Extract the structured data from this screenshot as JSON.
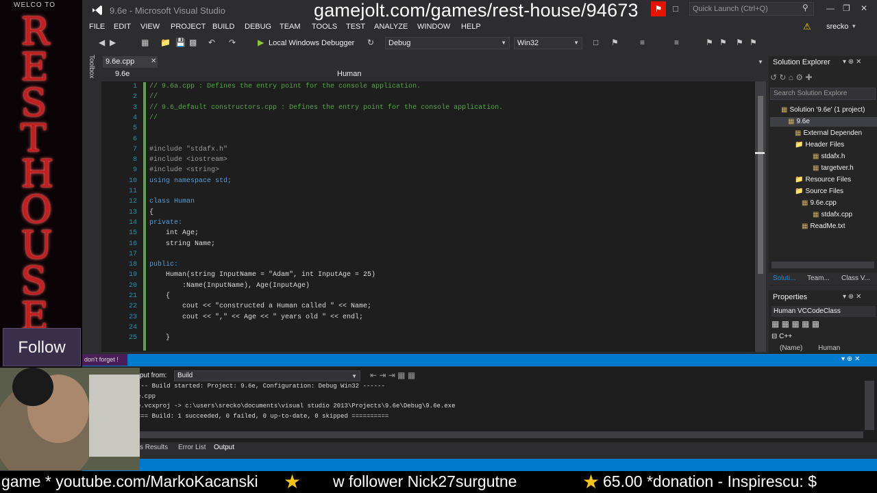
{
  "overlay": {
    "url": "gamejolt.com/games/rest-house/94673",
    "logo_top": "WELCO  TO",
    "logo_letters": [
      "R",
      "E",
      "S",
      "T",
      "H",
      "O",
      "U",
      "S",
      "E"
    ],
    "follow": "Follow",
    "dont_forget": "don't forget !",
    "ticker": {
      "segment1": "game * youtube.com/MarkoKacanski",
      "segment2": "w follower Nick27surgutne",
      "segment3": "65.00  *donation - Inspirescu: $"
    }
  },
  "window": {
    "title": "9.6e - Microsoft Visual Studio",
    "quick_launch_placeholder": "Quick Launch (Ctrl+Q)",
    "user": "srecko"
  },
  "menu": [
    "FILE",
    "EDIT",
    "VIEW",
    "PROJECT",
    "BUILD",
    "DEBUG",
    "TEAM",
    "TOOLS",
    "TEST",
    "ANALYZE",
    "WINDOW",
    "HELP"
  ],
  "toolbar": {
    "debugger": "Local Windows Debugger",
    "configuration": "Debug",
    "platform": "Win32"
  },
  "toolbox_label": "Toolbox",
  "editor": {
    "tab": "9.6e.cpp",
    "nav_scope": "9.6e",
    "nav_member": "Human",
    "lines": [
      {
        "n": "1",
        "t": "// 9.6a.cpp : Defines the entry point for the console application."
      },
      {
        "n": "2",
        "t": "//"
      },
      {
        "n": "3",
        "t": "// 9.6_default constructors.cpp : Defines the entry point for the console application."
      },
      {
        "n": "4",
        "t": "//"
      },
      {
        "n": "5",
        "t": ""
      },
      {
        "n": "6",
        "t": ""
      },
      {
        "n": "7",
        "t": "#include \"stdafx.h\""
      },
      {
        "n": "8",
        "t": "#include <iostream>"
      },
      {
        "n": "9",
        "t": "#include <string>"
      },
      {
        "n": "10",
        "t": "using namespace std;"
      },
      {
        "n": "11",
        "t": ""
      },
      {
        "n": "12",
        "t": "class Human"
      },
      {
        "n": "13",
        "t": "{"
      },
      {
        "n": "14",
        "t": "private:"
      },
      {
        "n": "15",
        "t": "    int Age;"
      },
      {
        "n": "16",
        "t": "    string Name;"
      },
      {
        "n": "17",
        "t": ""
      },
      {
        "n": "18",
        "t": "public:"
      },
      {
        "n": "19",
        "t": "    Human(string InputName = \"Adam\", int InputAge = 25)"
      },
      {
        "n": "20",
        "t": "        :Name(InputName), Age(InputAge)"
      },
      {
        "n": "21",
        "t": "    {"
      },
      {
        "n": "22",
        "t": "        cout << \"constructed a Human called \" << Name;"
      },
      {
        "n": "23",
        "t": "        cout << \",\" << Age << \" years old \" << endl;"
      },
      {
        "n": "24",
        "t": ""
      },
      {
        "n": "25",
        "t": "    }"
      }
    ]
  },
  "solution_explorer": {
    "title": "Solution Explorer",
    "search_placeholder": "Search Solution Explore",
    "items": [
      {
        "label": "Solution '9.6e' (1 project)"
      },
      {
        "label": "9.6e"
      },
      {
        "label": "External Dependen"
      },
      {
        "label": "Header Files"
      },
      {
        "label": "stdafx.h"
      },
      {
        "label": "targetver.h"
      },
      {
        "label": "Resource Files"
      },
      {
        "label": "Source Files"
      },
      {
        "label": "9.6e.cpp"
      },
      {
        "label": "stdafx.cpp"
      },
      {
        "label": "ReadMe.txt"
      }
    ],
    "tabs": [
      "Soluti...",
      "Team...",
      "Class V..."
    ]
  },
  "properties": {
    "title": "Properties",
    "object": "Human  VCCodeClass",
    "category": "C++",
    "row_name": "(Name)",
    "row_value": "Human"
  },
  "output": {
    "from_label": "put from:",
    "source": "Build",
    "lines": [
      "--- Build started: Project: 9.6e, Configuration: Debug Win32 ------",
      "e.cpp",
      "e.vcxproj -> c:\\users\\srecko\\documents\\visual studio 2013\\Projects\\9.6e\\Debug\\9.6e.exe",
      "=== Build: 1 succeeded, 0 failed, 0 up-to-date, 0 skipped =========="
    ],
    "tabs": [
      "s Results",
      "Error List",
      "Output"
    ]
  }
}
